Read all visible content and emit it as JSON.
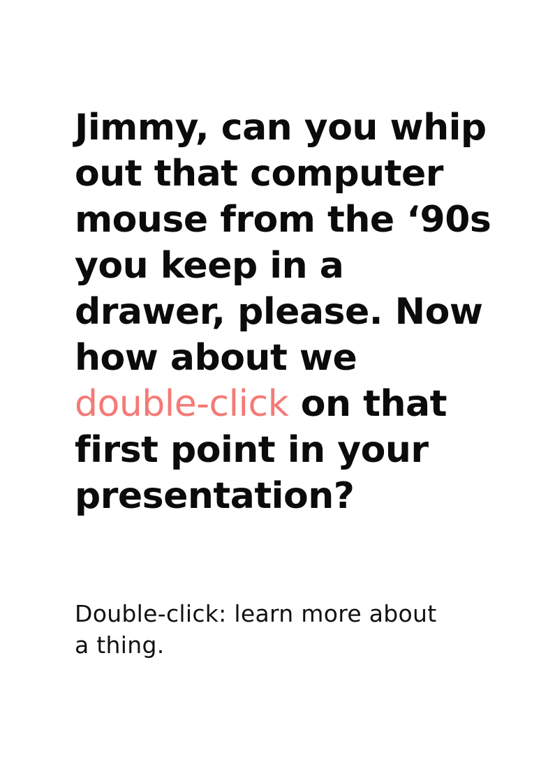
{
  "quote": {
    "lines": [
      "Jimmy, can you whip",
      "out that computer",
      "mouse from the ‘90s",
      "you keep in a",
      "drawer, please. Now",
      "how about we"
    ],
    "highlight_line": {
      "highlight": "double-click",
      "rest": " on that"
    },
    "lines_after": [
      "first point in your",
      "presentation?"
    ]
  },
  "definition": {
    "lines": [
      "Double-click: learn more about",
      "a thing."
    ]
  },
  "colors": {
    "text": "#0b0b0b",
    "highlight": "#f47a76",
    "background": "#ffffff"
  }
}
